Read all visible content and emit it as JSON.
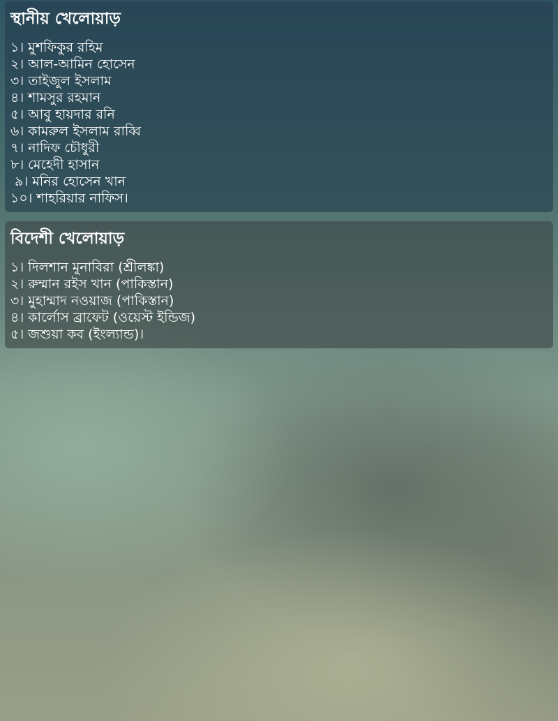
{
  "local_section": {
    "title": "স্থানীয় খেলোয়াড়",
    "players": [
      "১। মুশফিকুর রহিম",
      "২। আল-আমিন হোসেন",
      "৩। তাইজুল ইসলাম",
      "৪। শামসুর রহমান",
      "৫। আবু হায়দার রনি",
      "৬। কামরুল ইসলাম রাব্বি",
      "৭। নাদিফ চৌধুরী",
      "৮। মেহেদী হাসান",
      " ৯। মনির হোসেন খান",
      "১০। শাহরিয়ার নাফিস।"
    ]
  },
  "foreign_section": {
    "title": "বিদেশী খেলোয়াড়",
    "players": [
      "১। দিলশান মুনাবিরা (শ্রীলঙ্কা)",
      "২। রুম্মান রইস খান (পাকিস্তান)",
      "৩। মুহাম্মাদ নওয়াজ (পাকিস্তান)",
      "৪। কার্লোস ব্রাফেট (ওয়েস্ট ইন্ডিজ)",
      "৫। জশুয়া কব (ইংল্যান্ড)।"
    ]
  },
  "colors": {
    "text": "#ffffff",
    "panel_bg": "rgba(36,62,78,0.62)"
  }
}
